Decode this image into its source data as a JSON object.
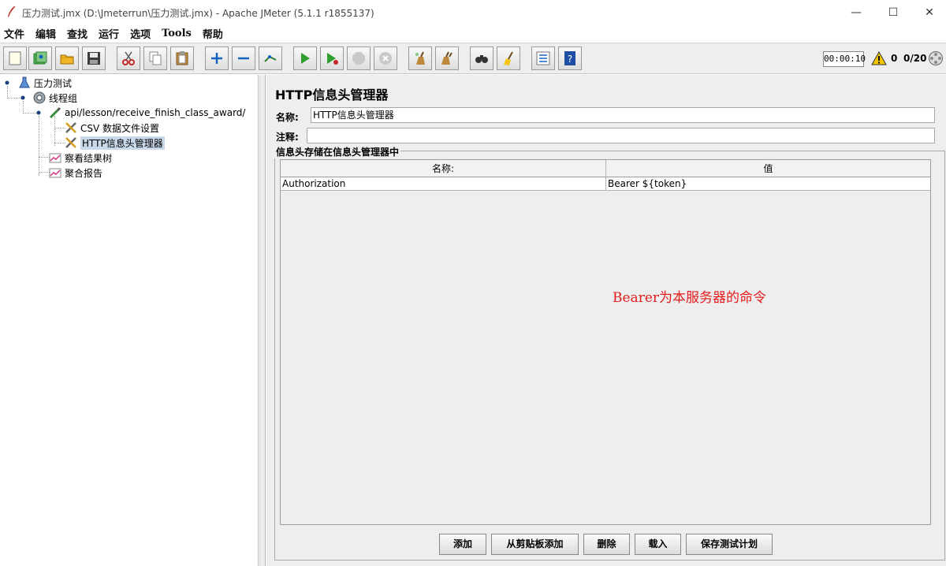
{
  "window": {
    "title": "压力测试.jmx (D:\\Jmeterrun\\压力测试.jmx) - Apache JMeter (5.1.1 r1855137)",
    "minimize_glyph": "—",
    "maximize_glyph": "☐",
    "close_glyph": "✕"
  },
  "menu": [
    "文件",
    "编辑",
    "查找",
    "运行",
    "选项",
    "Tools",
    "帮助"
  ],
  "toolbar": {
    "icons": [
      "new-icon",
      "templates-icon",
      "open-icon",
      "save-icon",
      "cut-icon",
      "copy-icon",
      "paste-icon",
      "expand-icon",
      "collapse-icon",
      "toggle-icon",
      "start-icon",
      "start-no-pause-icon",
      "stop-icon",
      "shutdown-icon",
      "clear-icon",
      "clear-all-icon",
      "search-icon",
      "reset-search-icon",
      "function-helper-icon",
      "help-icon"
    ],
    "elapsed_time": "00:00:10",
    "warning_count": "0",
    "active_threads": "0/20"
  },
  "tree": {
    "nodes": [
      {
        "label": "压力测试",
        "icon": "test-plan-icon"
      },
      {
        "label": "线程组",
        "icon": "thread-group-icon"
      },
      {
        "label": "api/lesson/receive_finish_class_award/",
        "icon": "sampler-icon"
      },
      {
        "label": "CSV 数据文件设置",
        "icon": "config-element-icon"
      },
      {
        "label": "HTTP信息头管理器",
        "icon": "config-element-icon"
      },
      {
        "label": "察看结果树",
        "icon": "listener-icon"
      },
      {
        "label": "聚合报告",
        "icon": "listener-icon"
      }
    ]
  },
  "editor": {
    "title": "HTTP信息头管理器",
    "name_label": "名称:",
    "name_value": "HTTP信息头管理器",
    "comment_label": "注释:",
    "comment_value": "",
    "group_title": "信息头存储在信息头管理器中",
    "table": {
      "columns": [
        "名称:",
        "值"
      ],
      "rows": [
        [
          "Authorization",
          "Bearer ${token}"
        ]
      ]
    },
    "annotation": "Bearer为本服务器的命令",
    "buttons": [
      "添加",
      "从剪贴板添加",
      "删除",
      "载入",
      "保存测试计划"
    ]
  }
}
